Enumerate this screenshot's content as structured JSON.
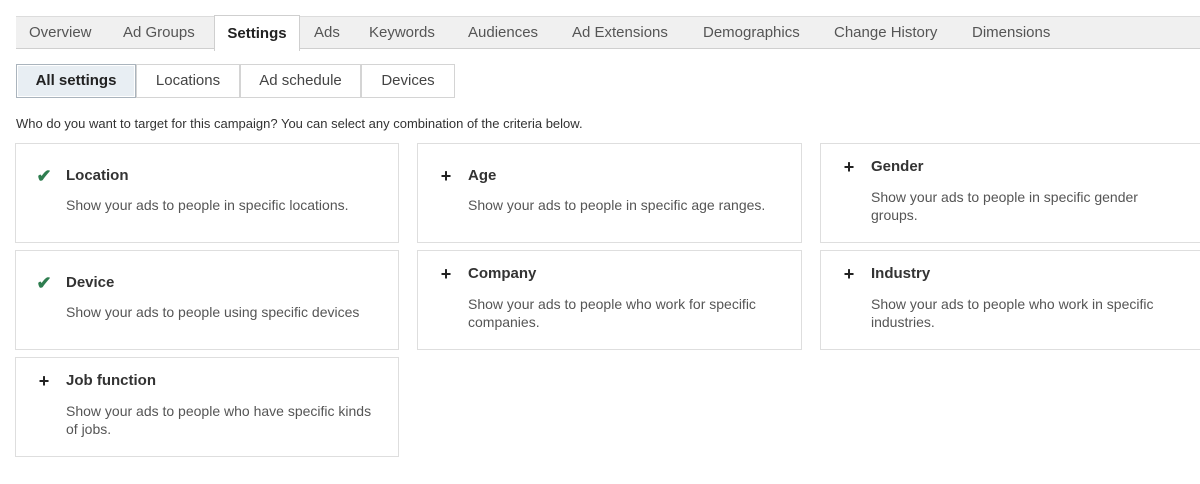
{
  "tabs": [
    {
      "label": "Overview"
    },
    {
      "label": "Ad Groups"
    },
    {
      "label": "Settings"
    },
    {
      "label": "Ads"
    },
    {
      "label": "Keywords"
    },
    {
      "label": "Audiences"
    },
    {
      "label": "Ad Extensions"
    },
    {
      "label": "Demographics"
    },
    {
      "label": "Change History"
    },
    {
      "label": "Dimensions"
    }
  ],
  "active_tab": "Settings",
  "subtabs": [
    {
      "label": "All settings"
    },
    {
      "label": "Locations"
    },
    {
      "label": "Ad schedule"
    },
    {
      "label": "Devices"
    }
  ],
  "active_subtab": "All settings",
  "prompt": "Who do you want to target for this campaign? You can select any combination of the criteria below.",
  "criteria": [
    {
      "title": "Location",
      "desc": "Show your ads to people in specific locations.",
      "state": "selected",
      "icon": "check-icon"
    },
    {
      "title": "Age",
      "desc": "Show your ads to people in specific age ranges.",
      "state": "add",
      "icon": "plus-icon"
    },
    {
      "title": "Gender",
      "desc": "Show your ads to people in specific gender groups.",
      "state": "add",
      "icon": "plus-icon"
    },
    {
      "title": "Device",
      "desc": "Show your ads to people using specific devices",
      "state": "selected",
      "icon": "check-icon"
    },
    {
      "title": "Company",
      "desc": "Show your ads to people who work for specific companies.",
      "state": "add",
      "icon": "plus-icon"
    },
    {
      "title": "Industry",
      "desc": "Show your ads to people who work in specific industries.",
      "state": "add",
      "icon": "plus-icon"
    },
    {
      "title": "Job function",
      "desc": "Show your ads to people who have specific kinds of jobs.",
      "state": "add",
      "icon": "plus-icon"
    }
  ],
  "colors": {
    "check": "#2e7d4f",
    "active_subtab_bg": "#e8eef3",
    "tabbar_bg": "#f0f0f0"
  }
}
